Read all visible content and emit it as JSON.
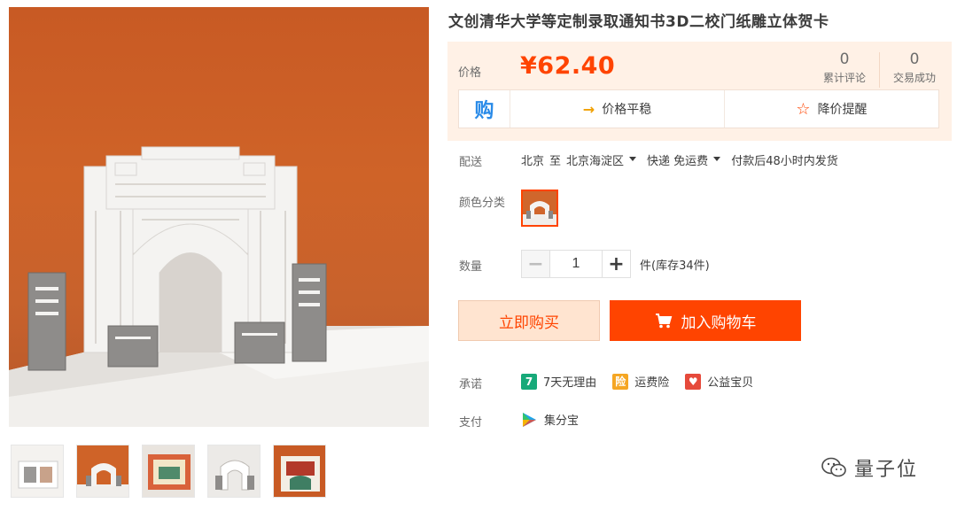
{
  "product": {
    "title": "文创清华大学等定制录取通知书3D二校门纸雕立体贺卡"
  },
  "price": {
    "label": "价格",
    "value": "¥62.40"
  },
  "stats": {
    "reviews_count": "0",
    "reviews_label": "累计评论",
    "sales_count": "0",
    "sales_label": "交易成功"
  },
  "trend": {
    "logo_text": "购",
    "stable_label": "价格平稳",
    "alert_label": "降价提醒"
  },
  "shipping": {
    "label": "配送",
    "from": "北京",
    "to_word": "至",
    "dest": "北京海淀区",
    "method": "快递 免运费",
    "note": "付款后48小时内发货"
  },
  "sku": {
    "label": "颜色分类"
  },
  "quantity": {
    "label": "数量",
    "minus": "−",
    "value": "1",
    "plus": "+",
    "stock": "件(库存34件)"
  },
  "actions": {
    "buy_now": "立即购买",
    "add_to_cart": "加入购物车"
  },
  "promise": {
    "label": "承诺",
    "items": [
      {
        "icon": "seven-days-icon",
        "badge": "7",
        "text": "7天无理由",
        "color": "#17a979"
      },
      {
        "icon": "shipping-insurance-icon",
        "badge": "险",
        "text": "运费险",
        "color": "#f5a623"
      },
      {
        "icon": "charity-icon",
        "badge": "♥",
        "text": "公益宝贝",
        "color": "#e64a3b"
      }
    ]
  },
  "payment": {
    "label": "支付",
    "method": "集分宝"
  },
  "watermark": {
    "text": "量子位"
  },
  "colors": {
    "accent": "#ff4400",
    "price_bg": "#fff1e6"
  }
}
